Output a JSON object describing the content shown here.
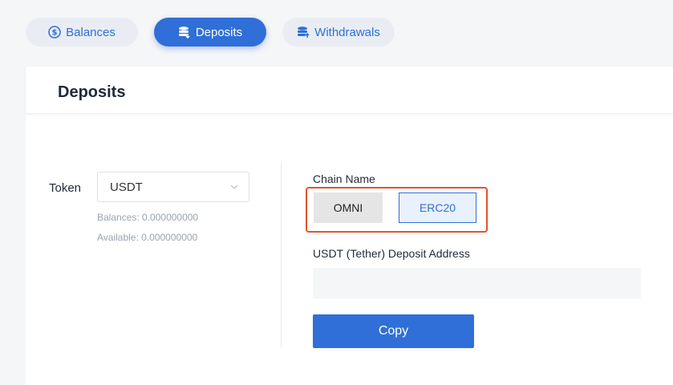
{
  "tabs": [
    {
      "label": "Balances",
      "icon": "dollar-circle-icon",
      "active": false
    },
    {
      "label": "Deposits",
      "icon": "deposit-stack-icon",
      "active": true
    },
    {
      "label": "Withdrawals",
      "icon": "withdraw-stack-icon",
      "active": false
    }
  ],
  "page": {
    "title": "Deposits"
  },
  "token": {
    "label": "Token",
    "selected": "USDT",
    "balances": "Balances: 0.000000000",
    "available": "Available: 0.000000000"
  },
  "chain": {
    "label": "Chain Name",
    "options": [
      "OMNI",
      "ERC20"
    ],
    "selected": "ERC20"
  },
  "address": {
    "label": "USDT (Tether) Deposit Address",
    "value": ""
  },
  "copy_label": "Copy",
  "colors": {
    "accent": "#2f6fd7",
    "highlight": "#e0542d",
    "background": "#f5f6f8"
  }
}
